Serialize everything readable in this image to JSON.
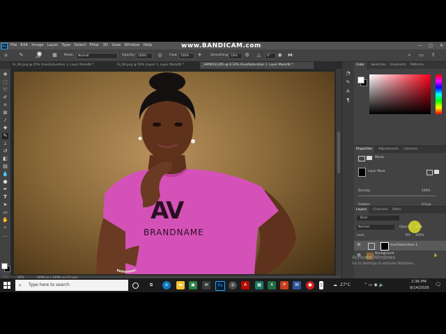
{
  "watermark": "www.BANDICAM.com",
  "menu": [
    "File",
    "Edit",
    "Image",
    "Layer",
    "Type",
    "Select",
    "Filter",
    "3D",
    "View",
    "Window",
    "Help"
  ],
  "app_logo": "Ps",
  "options": {
    "brush_size": "200",
    "mode_label": "Mode:",
    "mode_value": "Normal",
    "opacity_label": "Opacity:",
    "opacity_value": "100%",
    "flow_label": "Flow:",
    "flow_value": "100%",
    "smoothing_label": "Smoothing:",
    "smoothing_value": "10%",
    "angle_value": "0°"
  },
  "tabs": [
    "IG_04.png @ 25% (Hue/Saturation 1, Layer Mask/8) *",
    "IG_04.png @ 50% (Layer 1, Layer Mask/8) *",
    "_SAM0233.JPG @ 8.33% (Hue/Saturation 1, Layer Mask/8) *"
  ],
  "status": {
    "zoom": "25%",
    "dimensions": "4096 px x 4096 px (72 ppi)"
  },
  "color_panel": {
    "tabs": [
      "Color",
      "Swatches",
      "Gradients",
      "Patterns"
    ]
  },
  "properties_panel": {
    "tabs": [
      "Properties",
      "Adjustments",
      "Libraries"
    ],
    "masks_label": "Masks",
    "layer_mask_label": "Layer Mask",
    "density_label": "Density:",
    "density_value": "100%",
    "feather_label": "Feather:",
    "feather_value": "0.0 px"
  },
  "layers_panel": {
    "tabs": [
      "Layers",
      "Channels",
      "Paths"
    ],
    "kind_label": "Kind",
    "blend_mode": "Normal",
    "opacity_label": "Opacity:",
    "opacity_value": "45%",
    "lock_label": "Lock:",
    "fill_label": "Fill:",
    "fill_value": "100%",
    "layers": [
      {
        "name": "Hue/Saturation 1"
      },
      {
        "name": "Background"
      }
    ]
  },
  "activation": {
    "title": "Activate Windows",
    "subtitle": "Go to Settings to activate Windows."
  },
  "shirt_text": {
    "logo": "AV",
    "brand": "BRANDNAME"
  },
  "taskbar": {
    "search_placeholder": "Type here to search",
    "weather": "27°C",
    "time": "2:36 PM",
    "date": "9/14/2026"
  },
  "colors": {
    "ui_dark": "#323232",
    "panel": "#424242",
    "shirt": "#d452b7",
    "accent": "#31a8ff"
  }
}
